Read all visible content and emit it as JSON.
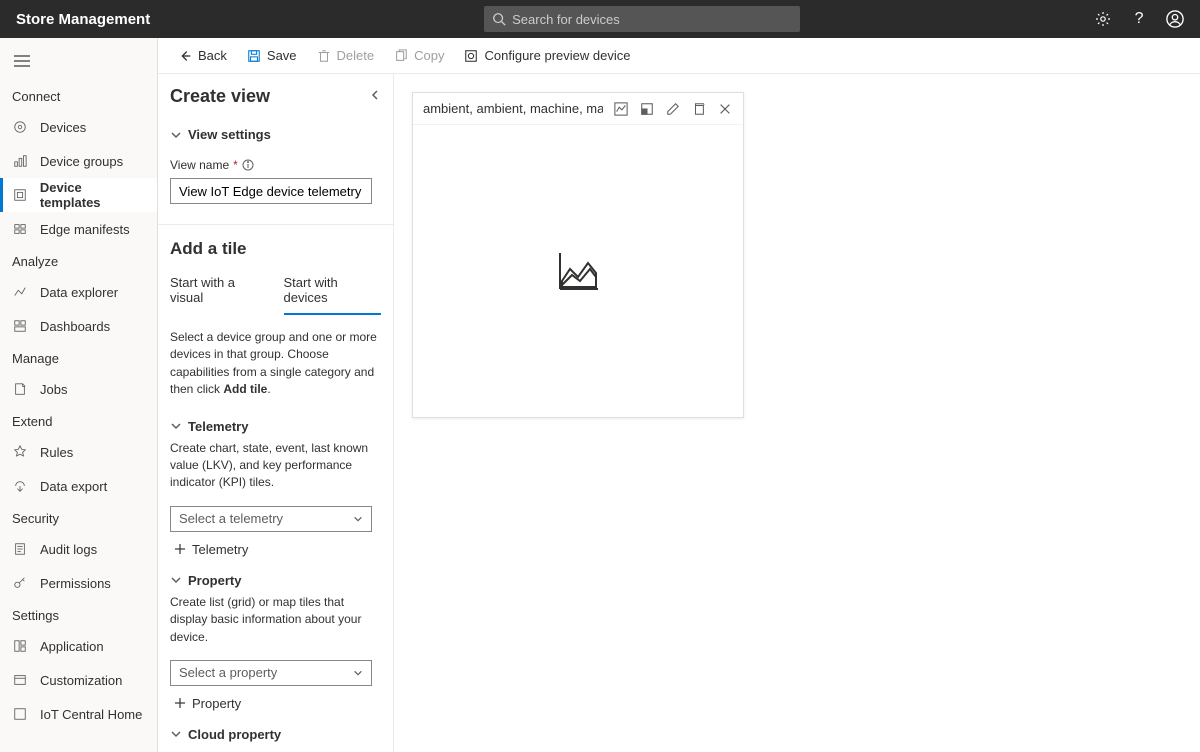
{
  "header": {
    "title": "Store Management",
    "search_placeholder": "Search for devices"
  },
  "sidebar": {
    "sections": [
      {
        "label": "Connect",
        "items": [
          {
            "icon": "devices",
            "label": "Devices"
          },
          {
            "icon": "device-groups",
            "label": "Device groups"
          },
          {
            "icon": "device-templates",
            "label": "Device templates",
            "active": true
          },
          {
            "icon": "edge-manifests",
            "label": "Edge manifests"
          }
        ]
      },
      {
        "label": "Analyze",
        "items": [
          {
            "icon": "data-explorer",
            "label": "Data explorer"
          },
          {
            "icon": "dashboards",
            "label": "Dashboards"
          }
        ]
      },
      {
        "label": "Manage",
        "items": [
          {
            "icon": "jobs",
            "label": "Jobs"
          }
        ]
      },
      {
        "label": "Extend",
        "items": [
          {
            "icon": "rules",
            "label": "Rules"
          },
          {
            "icon": "data-export",
            "label": "Data export"
          }
        ]
      },
      {
        "label": "Security",
        "items": [
          {
            "icon": "audit-logs",
            "label": "Audit logs"
          },
          {
            "icon": "permissions",
            "label": "Permissions"
          }
        ]
      },
      {
        "label": "Settings",
        "items": [
          {
            "icon": "application",
            "label": "Application"
          },
          {
            "icon": "customization",
            "label": "Customization"
          },
          {
            "icon": "iot-central-home",
            "label": "IoT Central Home"
          }
        ]
      }
    ]
  },
  "commandbar": {
    "back": "Back",
    "save": "Save",
    "delete": "Delete",
    "copy": "Copy",
    "configure": "Configure preview device"
  },
  "panel": {
    "title": "Create view",
    "view_settings": "View settings",
    "view_name_label": "View name",
    "view_name_value": "View IoT Edge device telemetry",
    "add_a_tile": "Add a tile",
    "tabs": {
      "visual": "Start with a visual",
      "devices": "Start with devices"
    },
    "devices_help_pre": "Select a device group and one or more devices in that group. Choose capabilities from a single category and then click ",
    "devices_help_bold": "Add tile",
    "telemetry": {
      "header": "Telemetry",
      "desc": "Create chart, state, event, last known value (LKV), and key performance indicator (KPI) tiles.",
      "placeholder": "Select a telemetry",
      "add": "Telemetry"
    },
    "property": {
      "header": "Property",
      "desc": "Create list (grid) or map tiles that display basic information about your device.",
      "placeholder": "Select a property",
      "add": "Property"
    },
    "cloud": {
      "header": "Cloud property"
    }
  },
  "tile": {
    "name": "ambient, ambient, machine, machine"
  }
}
